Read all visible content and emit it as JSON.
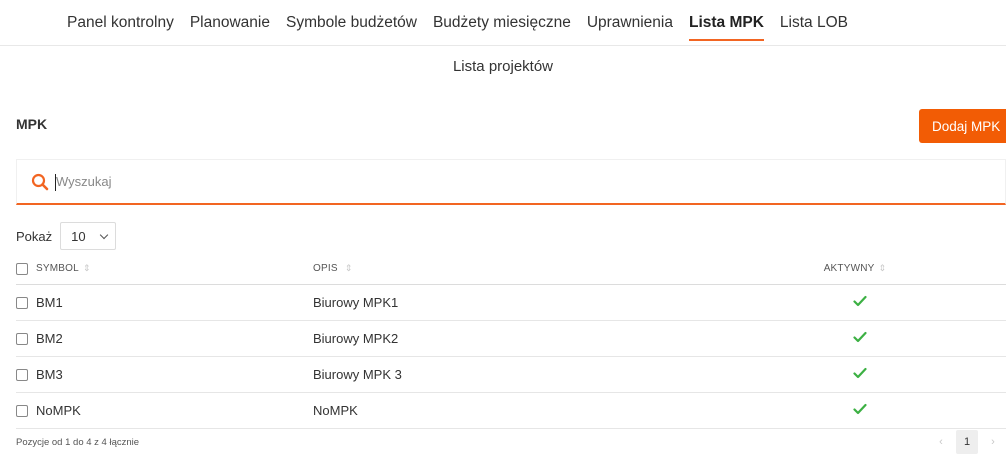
{
  "nav": {
    "items": [
      {
        "label": "Panel kontrolny",
        "active": false
      },
      {
        "label": "Planowanie",
        "active": false
      },
      {
        "label": "Symbole budżetów",
        "active": false
      },
      {
        "label": "Budżety miesięczne",
        "active": false
      },
      {
        "label": "Uprawnienia",
        "active": false
      },
      {
        "label": "Lista MPK",
        "active": true
      },
      {
        "label": "Lista LOB",
        "active": false
      }
    ]
  },
  "page": {
    "title": "Lista projektów"
  },
  "section": {
    "title": "MPK",
    "add_button": "Dodaj MPK"
  },
  "search": {
    "placeholder": "Wyszukaj",
    "value": ""
  },
  "page_size": {
    "label": "Pokaż",
    "value": "10"
  },
  "table": {
    "headers": {
      "symbol": "SYMBOL",
      "opis": "OPIS",
      "aktywny": "AKTYWNY"
    },
    "rows": [
      {
        "symbol": "BM1",
        "opis": "Biurowy MPK1",
        "aktywny": true
      },
      {
        "symbol": "BM2",
        "opis": "Biurowy MPK2",
        "aktywny": true
      },
      {
        "symbol": "BM3",
        "opis": "Biurowy MPK 3",
        "aktywny": true
      },
      {
        "symbol": "NoMPK",
        "opis": "NoMPK",
        "aktywny": true
      }
    ]
  },
  "footer": {
    "summary": "Pozycje od 1 do 4 z 4 łącznie"
  },
  "pagination": {
    "current_page": "1",
    "prev_icon": "‹",
    "next_icon": "›"
  },
  "colors": {
    "accent": "#f26522",
    "button": "#f25c05",
    "check": "#3cb043"
  }
}
